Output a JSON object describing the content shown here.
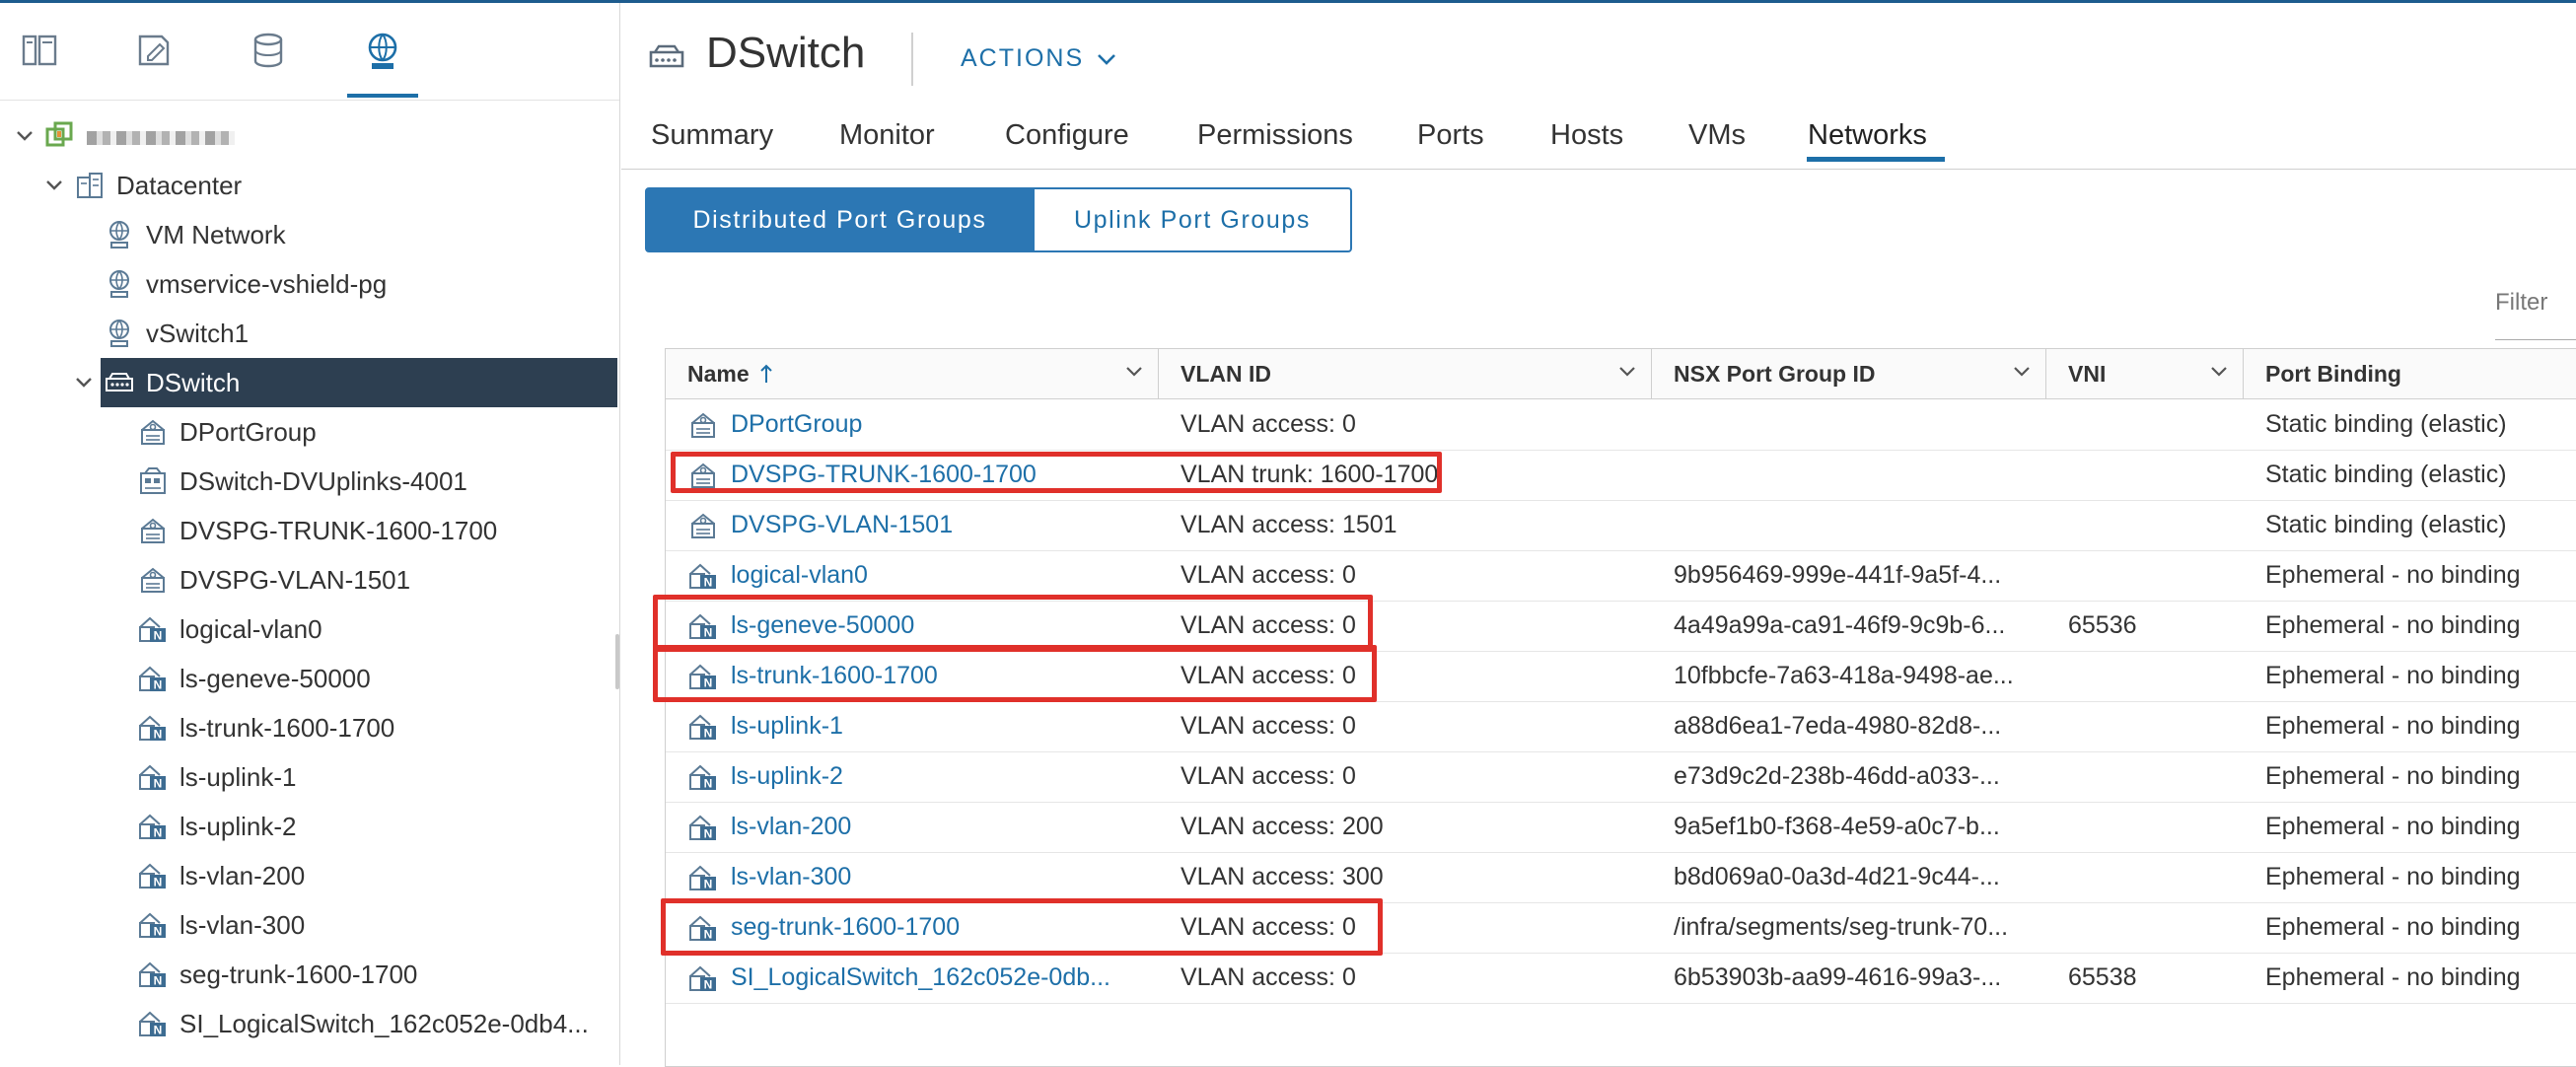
{
  "app": {
    "accent_color": "#1d6fa8",
    "selection_color": "#2d3f51",
    "highlight_color": "#e0302a"
  },
  "navigator": {
    "tabs": [
      {
        "icon": "hosts-and-clusters-icon"
      },
      {
        "icon": "vms-and-templates-icon"
      },
      {
        "icon": "storage-icon"
      },
      {
        "icon": "networking-icon",
        "active": true
      }
    ],
    "tree": [
      {
        "label": "",
        "icon": "vcenter-icon",
        "redacted": true,
        "expanded": true
      },
      {
        "label": "Datacenter",
        "icon": "datacenter-icon",
        "expanded": true
      },
      {
        "label": "VM Network",
        "icon": "network-icon"
      },
      {
        "label": "vmservice-vshield-pg",
        "icon": "network-icon"
      },
      {
        "label": "vSwitch1",
        "icon": "network-icon"
      },
      {
        "label": "DSwitch",
        "icon": "dswitch-icon",
        "expanded": true,
        "selected": true
      },
      {
        "label": "DPortGroup",
        "icon": "portgroup-icon"
      },
      {
        "label": "DSwitch-DVUplinks-4001",
        "icon": "uplink-portgroup-icon"
      },
      {
        "label": "DVSPG-TRUNK-1600-1700",
        "icon": "portgroup-icon"
      },
      {
        "label": "DVSPG-VLAN-1501",
        "icon": "portgroup-icon"
      },
      {
        "label": "logical-vlan0",
        "icon": "nsx-portgroup-icon"
      },
      {
        "label": "ls-geneve-50000",
        "icon": "nsx-portgroup-icon"
      },
      {
        "label": "ls-trunk-1600-1700",
        "icon": "nsx-portgroup-icon"
      },
      {
        "label": "ls-uplink-1",
        "icon": "nsx-portgroup-icon"
      },
      {
        "label": "ls-uplink-2",
        "icon": "nsx-portgroup-icon"
      },
      {
        "label": "ls-vlan-200",
        "icon": "nsx-portgroup-icon"
      },
      {
        "label": "ls-vlan-300",
        "icon": "nsx-portgroup-icon"
      },
      {
        "label": "seg-trunk-1600-1700",
        "icon": "nsx-portgroup-icon"
      },
      {
        "label": "SI_LogicalSwitch_162c052e-0db4...",
        "icon": "nsx-portgroup-icon"
      }
    ]
  },
  "header": {
    "title": "DSwitch",
    "title_icon": "dswitch-icon",
    "actions_label": "ACTIONS",
    "tabs": [
      {
        "label": "Summary"
      },
      {
        "label": "Monitor"
      },
      {
        "label": "Configure"
      },
      {
        "label": "Permissions"
      },
      {
        "label": "Ports"
      },
      {
        "label": "Hosts"
      },
      {
        "label": "VMs"
      },
      {
        "label": "Networks",
        "active": true
      }
    ]
  },
  "toggle": {
    "active_label": "Distributed Port Groups",
    "inactive_label": "Uplink Port Groups"
  },
  "filter": {
    "label": "Filter"
  },
  "grid": {
    "columns": [
      {
        "label": "Name",
        "sorted": "ascending"
      },
      {
        "label": "VLAN ID"
      },
      {
        "label": "NSX Port Group ID"
      },
      {
        "label": "VNI"
      },
      {
        "label": "Port Binding"
      }
    ],
    "rows": [
      {
        "name": "DPortGroup",
        "icon": "portgroup-icon",
        "vlan": "VLAN access: 0",
        "nsx": "",
        "vni": "",
        "binding": "Static binding (elastic)"
      },
      {
        "name": "DVSPG-TRUNK-1600-1700",
        "icon": "portgroup-icon",
        "vlan": "VLAN trunk: 1600-1700",
        "nsx": "",
        "vni": "",
        "binding": "Static binding (elastic)",
        "highlighted": true
      },
      {
        "name": "DVSPG-VLAN-1501",
        "icon": "portgroup-icon",
        "vlan": "VLAN access: 1501",
        "nsx": "",
        "vni": "",
        "binding": "Static binding (elastic)"
      },
      {
        "name": "logical-vlan0",
        "icon": "nsx-portgroup-icon",
        "vlan": "VLAN access: 0",
        "nsx": "9b956469-999e-441f-9a5f-4...",
        "vni": "",
        "binding": "Ephemeral - no binding"
      },
      {
        "name": "ls-geneve-50000",
        "icon": "nsx-portgroup-icon",
        "vlan": "VLAN access: 0",
        "nsx": "4a49a99a-ca91-46f9-9c9b-6...",
        "vni": "65536",
        "binding": "Ephemeral - no binding",
        "highlighted": true
      },
      {
        "name": "ls-trunk-1600-1700",
        "icon": "nsx-portgroup-icon",
        "vlan": "VLAN access: 0",
        "nsx": "10fbbcfe-7a63-418a-9498-ae...",
        "vni": "",
        "binding": "Ephemeral - no binding",
        "highlighted": true
      },
      {
        "name": "ls-uplink-1",
        "icon": "nsx-portgroup-icon",
        "vlan": "VLAN access: 0",
        "nsx": "a88d6ea1-7eda-4980-82d8-...",
        "vni": "",
        "binding": "Ephemeral - no binding"
      },
      {
        "name": "ls-uplink-2",
        "icon": "nsx-portgroup-icon",
        "vlan": "VLAN access: 0",
        "nsx": "e73d9c2d-238b-46dd-a033-...",
        "vni": "",
        "binding": "Ephemeral - no binding"
      },
      {
        "name": "ls-vlan-200",
        "icon": "nsx-portgroup-icon",
        "vlan": "VLAN access: 200",
        "nsx": "9a5ef1b0-f368-4e59-a0c7-b...",
        "vni": "",
        "binding": "Ephemeral - no binding"
      },
      {
        "name": "ls-vlan-300",
        "icon": "nsx-portgroup-icon",
        "vlan": "VLAN access: 300",
        "nsx": "b8d069a0-0a3d-4d21-9c44-...",
        "vni": "",
        "binding": "Ephemeral - no binding"
      },
      {
        "name": "seg-trunk-1600-1700",
        "icon": "nsx-portgroup-icon",
        "vlan": "VLAN access: 0",
        "nsx": "/infra/segments/seg-trunk-70...",
        "vni": "",
        "binding": "Ephemeral - no binding",
        "highlighted": true
      },
      {
        "name": "SI_LogicalSwitch_162c052e-0db...",
        "icon": "nsx-portgroup-icon",
        "vlan": "VLAN access: 0",
        "nsx": "6b53903b-aa99-4616-99a3-...",
        "vni": "65538",
        "binding": "Ephemeral - no binding"
      }
    ]
  }
}
